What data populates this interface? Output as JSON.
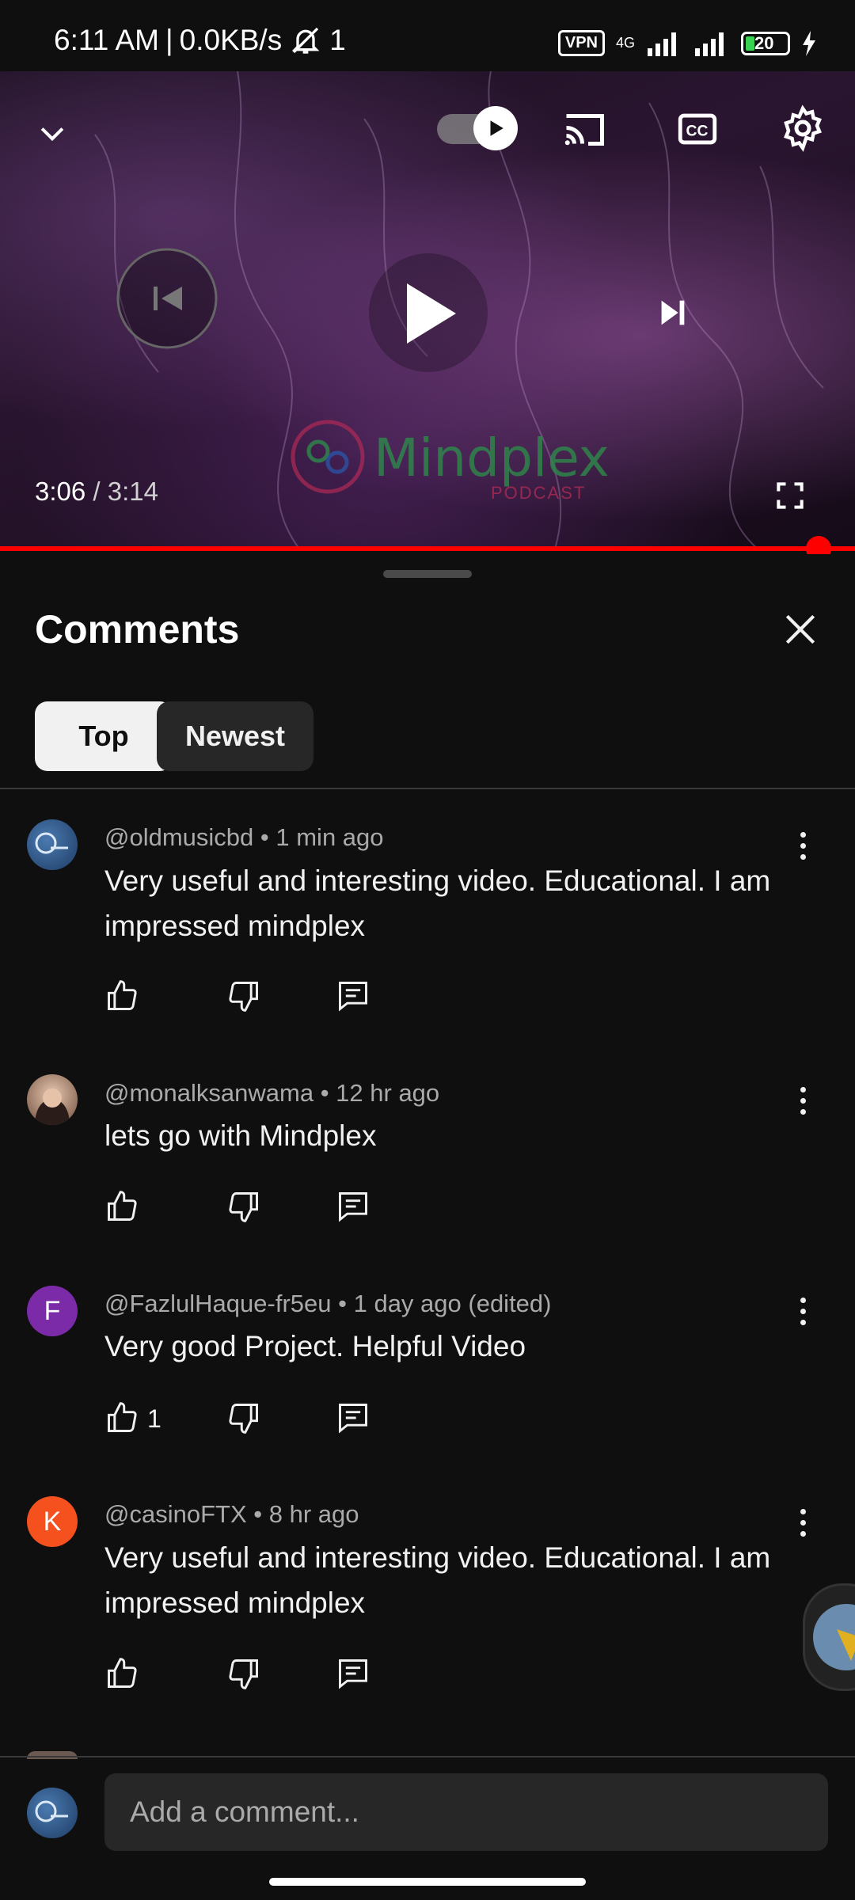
{
  "status_bar": {
    "time": "6:11 AM",
    "speed": "0.0KB/s",
    "notification_count": "1",
    "vpn": "VPN",
    "network": "4G",
    "battery": "20"
  },
  "player": {
    "current_time": "3:06",
    "separator": " / ",
    "duration": "3:14",
    "progress_fraction": 0.957,
    "logo_text": "Mindplex",
    "logo_subtext": "PODCAST"
  },
  "sheet": {
    "title": "Comments",
    "chips": [
      "Top",
      "Newest"
    ],
    "selected_chip": "Top"
  },
  "comments": [
    {
      "author": "@oldmusicbd",
      "time": "1 min ago",
      "text": "Very useful and interesting video. Educational. I am impressed mindplex",
      "likes": ""
    },
    {
      "author": "@monalksanwama",
      "time": "12 hr ago",
      "text": "lets go with Mindplex",
      "likes": ""
    },
    {
      "author": "@FazlulHaque-fr5eu",
      "time": "1 day ago (edited)",
      "text": "Very good Project. Helpful Video",
      "likes": "1",
      "avatar_letter": "F",
      "avatar_color": "#7b2aa8"
    },
    {
      "author": "@casinoFTX",
      "time": "8 hr ago",
      "text": "Very useful and interesting video. Educational. I am impressed mindplex",
      "likes": "",
      "avatar_letter": "K",
      "avatar_color": "#f4511e"
    }
  ],
  "meta_separator": " • ",
  "composer": {
    "placeholder": "Add a comment..."
  }
}
